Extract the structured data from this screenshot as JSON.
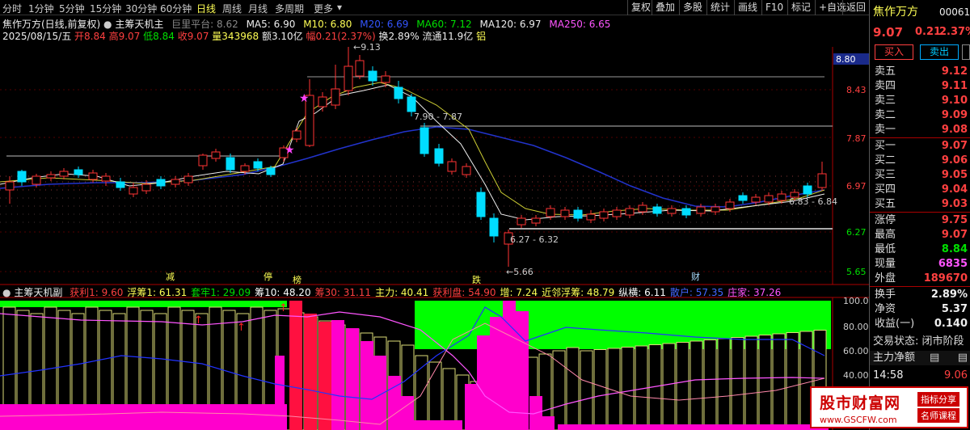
{
  "toolbar": {
    "periods": [
      "分时",
      "1分钟",
      "5分钟",
      "15分钟",
      "30分钟",
      "60分钟",
      "日线",
      "周线",
      "月线",
      "多周期",
      "更多"
    ],
    "active_period": "日线",
    "buttons": [
      "复权",
      "叠加",
      "多股",
      "统计",
      "画线",
      "F10",
      "标记",
      "+自选",
      "返回"
    ]
  },
  "info_line1": {
    "title": "焦作万方(日线,前复权)",
    "indicator": "主筹天机主",
    "platform_label": "巨里平台: 8.62",
    "ma5": "MA5: 6.90",
    "ma10": "M10: 6.80",
    "ma20": "M20: 6.69",
    "ma60": "MA60: 7.12",
    "ma120": "MA120: 6.97",
    "ma250": "MA250: 6.65"
  },
  "info_line2": {
    "date": "2025/08/15/五",
    "open": "开8.84",
    "high": "高9.07",
    "low": "低8.84",
    "close": "收9.07",
    "volume": "量343968",
    "amount": "额3.10亿",
    "change": "幅0.21(2.37%)",
    "turnover": "换2.89%",
    "float": "流通11.9亿",
    "sector": "铝"
  },
  "main_axis": {
    "ticks": [
      "8.43",
      "7.87",
      "7.31",
      "6.97",
      "6.27",
      "5.65"
    ],
    "current_price_box": "8.80"
  },
  "annotations": {
    "high": "9.13",
    "mid_range": "7.90 - 7.87",
    "low_range": "6.27 - 6.32",
    "low": "5.66",
    "right_range": "6.83 - 6.84",
    "markers": [
      "减",
      "停",
      "榜",
      "跌",
      "财"
    ]
  },
  "sub_indicator": {
    "name": "主筹天机副",
    "items": [
      {
        "text": "获利1: 9.60",
        "color": "#ff4040"
      },
      {
        "text": "浮筹1: 61.31",
        "color": "#ffff55"
      },
      {
        "text": "套牢1: 29.09",
        "color": "#00e000"
      },
      {
        "text": "筹10: 48.20",
        "color": "#ffffff"
      },
      {
        "text": "筹30: 31.11",
        "color": "#ff4040"
      },
      {
        "text": "主力: 40.41",
        "color": "#ffff55"
      },
      {
        "text": "获利盘: 54.90",
        "color": "#ff4040"
      },
      {
        "text": "增: 7.24",
        "color": "#ffff55"
      },
      {
        "text": "近邻浮筹: 48.79",
        "color": "#ffff55"
      },
      {
        "text": "纵横: 6.11",
        "color": "#ffffff"
      },
      {
        "text": "散户: 57.35",
        "color": "#4466ff"
      },
      {
        "text": "庄家: 37.26",
        "color": "#ff55ff"
      }
    ],
    "ticks": [
      "100.0",
      "80.00",
      "60.00",
      "40.00"
    ]
  },
  "right_panel": {
    "name": "焦作万方",
    "code": "000612",
    "price": "9.07",
    "change": "0.21",
    "change_pct": "2.37%",
    "buy_label": "买入",
    "sell_label": "卖出",
    "ask": [
      {
        "label": "卖五",
        "price": "9.12"
      },
      {
        "label": "卖四",
        "price": "9.11"
      },
      {
        "label": "卖三",
        "price": "9.10"
      },
      {
        "label": "卖二",
        "price": "9.09"
      },
      {
        "label": "卖一",
        "price": "9.08"
      }
    ],
    "bid": [
      {
        "label": "买一",
        "price": "9.07"
      },
      {
        "label": "买二",
        "price": "9.06"
      },
      {
        "label": "买三",
        "price": "9.05"
      },
      {
        "label": "买四",
        "price": "9.04"
      },
      {
        "label": "买五",
        "price": "9.03"
      }
    ],
    "stats": [
      {
        "label": "涨停",
        "value": "9.75",
        "color": "#ff4040"
      },
      {
        "label": "最高",
        "value": "9.07",
        "color": "#ff4040"
      },
      {
        "label": "最低",
        "value": "8.84",
        "color": "#00e000"
      },
      {
        "label": "现量",
        "value": "6835",
        "color": "#ff55ff"
      },
      {
        "label": "外盘",
        "value": "189670",
        "color": "#ff4040"
      }
    ],
    "stats2": [
      {
        "label": "换手",
        "value": "2.89%",
        "color": "#eeeeee"
      },
      {
        "label": "净资",
        "value": "5.37",
        "color": "#eeeeee"
      },
      {
        "label": "收益(一)",
        "value": "0.140",
        "color": "#eeeeee"
      }
    ],
    "trade_status": "交易状态: 闭市阶段",
    "main_net_label": "主力净额",
    "tick_time": "14:58",
    "tick_price": "9.06"
  },
  "watermark": {
    "title": "股市财富网",
    "sub1": "指标分享",
    "sub2": "名师课程",
    "url": "www.GSCFW.com"
  }
}
